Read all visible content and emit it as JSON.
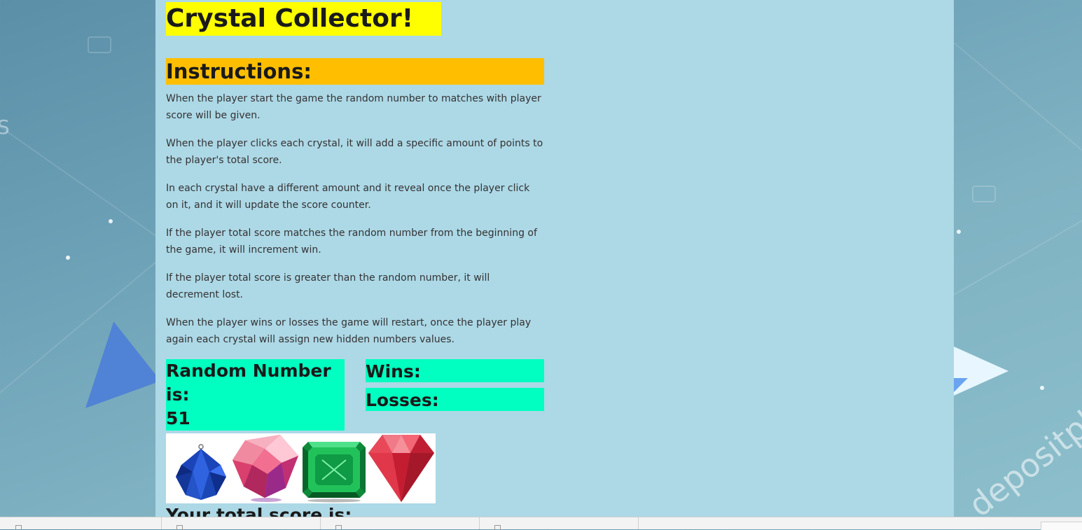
{
  "game": {
    "title": "Crystal Collector!",
    "instructions_heading": "Instructions:",
    "instructions": [
      "When the player start the game the random number to matches with player score will be given.",
      "When the player clicks each crystal, it will add a specific amount of points to the player's total score.",
      "In each crystal have a different amount and it reveal once the player click on it, and it will update the score counter.",
      "If the player total score matches the random number from the beginning of the game, it will increment win.",
      "If the player total score is greater than the random number, it will decrement lost.",
      "When the player wins or losses the game will restart, once the player play again each crystal will assign new hidden numbers values."
    ],
    "random_label": "Random Number is:",
    "random_value": "51",
    "wins_label": "Wins:",
    "wins_value": "",
    "losses_label": "Losses:",
    "losses_value": "",
    "score_label": "Your total score is:",
    "crystals": [
      {
        "name": "blue-crystal",
        "color": "#1a44b8"
      },
      {
        "name": "pink-crystal",
        "color": "#e8507a"
      },
      {
        "name": "green-crystal",
        "color": "#16a84a"
      },
      {
        "name": "red-crystal",
        "color": "#d8263c"
      }
    ]
  },
  "background": {
    "watermark": "depositphotos",
    "colors": {
      "panel": "#add8e6",
      "title_bg": "#ffff00",
      "instructions_bg": "#ffbf00",
      "stat_bg": "#00ffc0"
    }
  }
}
